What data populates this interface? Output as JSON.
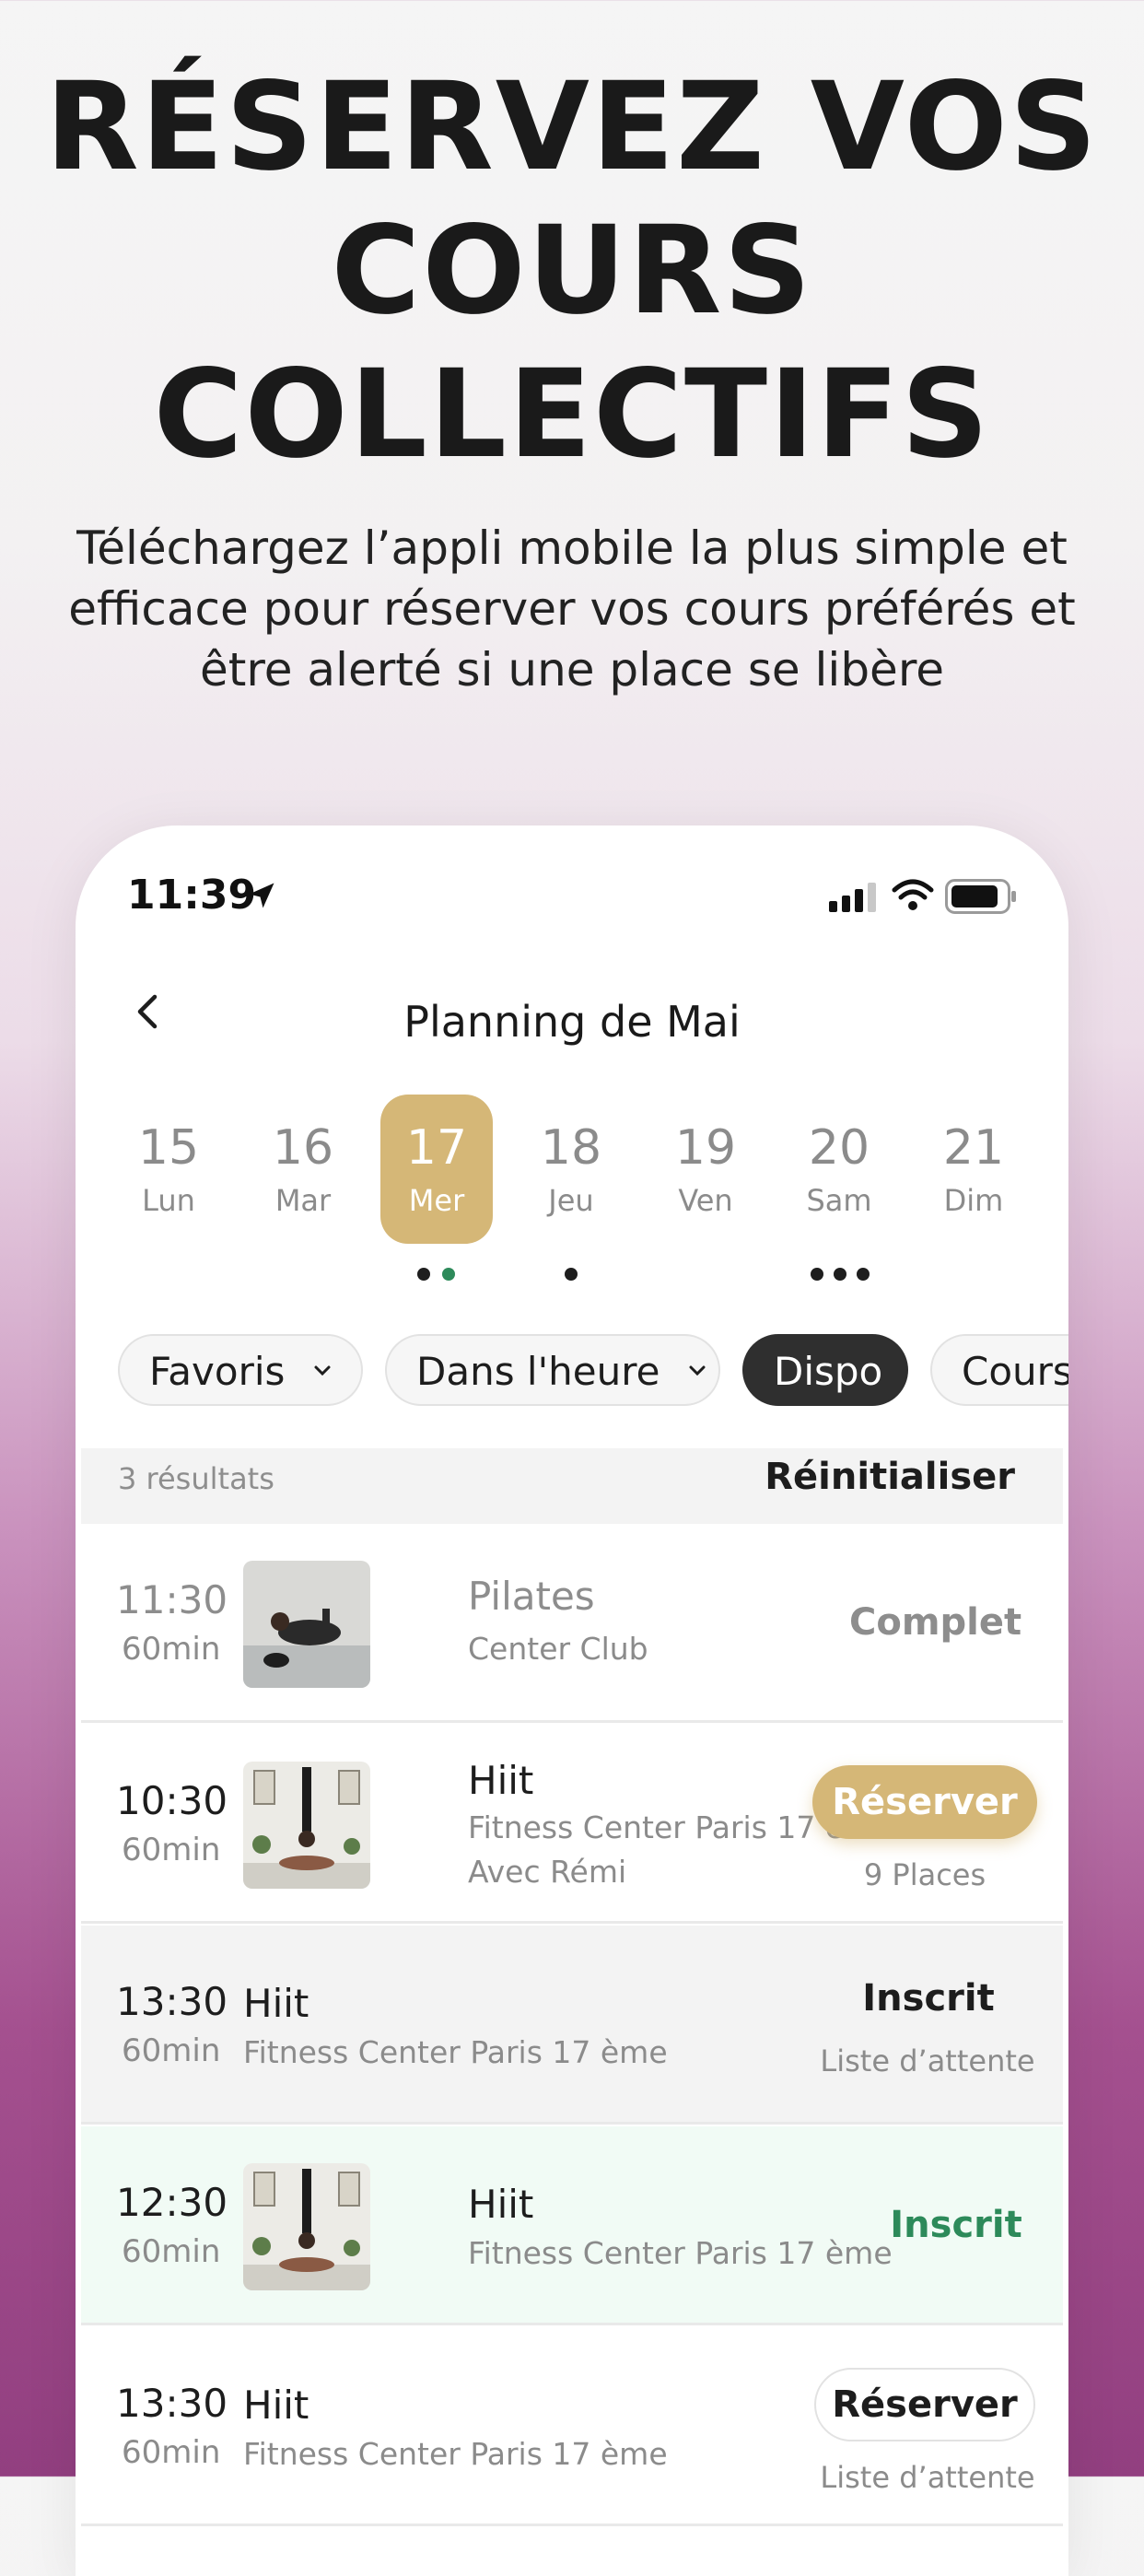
{
  "hero": {
    "headline_line1": "RÉSERVEZ VOS",
    "headline_line2": "COURS",
    "headline_line3": "COLLECTIFS",
    "subtitle_line1": "Téléchargez l’appli mobile la plus simple et",
    "subtitle_line2": "efficace pour réserver vos cours préférés et",
    "subtitle_line3": "être alerté si une place se libère"
  },
  "status_bar": {
    "time": "11:39",
    "icons": [
      "location-arrow-icon",
      "signal-icon",
      "wifi-icon",
      "battery-icon"
    ]
  },
  "header": {
    "title": "Planning de Mai",
    "back_icon": "chevron-left-icon"
  },
  "days": [
    {
      "num": "15",
      "name": "Lun"
    },
    {
      "num": "16",
      "name": "Mar"
    },
    {
      "num": "17",
      "name": "Mer",
      "selected": true
    },
    {
      "num": "18",
      "name": "Jeu"
    },
    {
      "num": "19",
      "name": "Ven"
    },
    {
      "num": "20",
      "name": "Sam"
    },
    {
      "num": "21",
      "name": "Dim"
    }
  ],
  "filters": {
    "favoris": "Favoris",
    "dans_lheure": "Dans l'heure",
    "dispo": "Dispo",
    "cours": "Cours"
  },
  "results": {
    "count": "3 résultats",
    "reset": "Réinitialiser"
  },
  "classes": [
    {
      "time": "11:30",
      "duration": "60min",
      "title": "Pilates",
      "line1": "Center Club",
      "status": "Complet"
    },
    {
      "time": "10:30",
      "duration": "60min",
      "title": "Hiit",
      "line1": "Fitness Center Paris 17 ème",
      "line2": "Avec Rémi",
      "button": "Réserver",
      "places": "9 Places"
    },
    {
      "time": "13:30",
      "duration": "60min",
      "title": "Hiit",
      "line1": "Fitness Center Paris 17 ème",
      "status": "Inscrit",
      "substatus": "Liste d’attente"
    },
    {
      "time": "12:30",
      "duration": "60min",
      "title": "Hiit",
      "line1": "Fitness Center Paris 17 ème",
      "status": "Inscrit"
    },
    {
      "time": "13:30",
      "duration": "60min",
      "title": "Hiit",
      "line1": "Fitness Center Paris 17 ème",
      "button": "Réserver",
      "substatus": "Liste d’attente"
    }
  ],
  "colors": {
    "gold": "#d5b777",
    "green": "#2d8a5a",
    "dark_chip": "#2f2f2f"
  }
}
